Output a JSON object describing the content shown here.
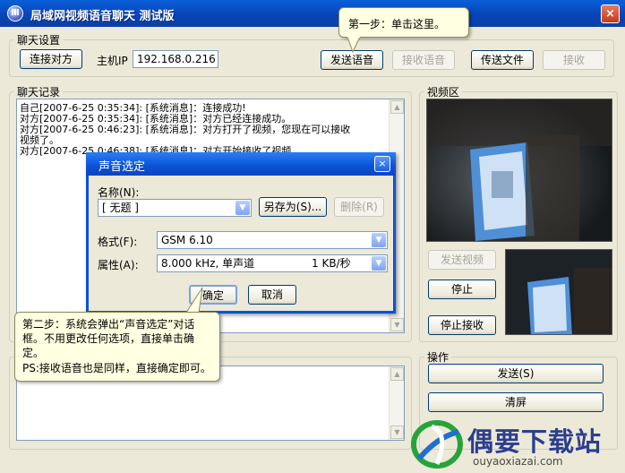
{
  "window": {
    "title": "局域网视频语音聊天  测试版",
    "close_label": "×",
    "icon_label": "Ⅲ"
  },
  "chat_settings": {
    "group_label": "聊天设置",
    "connect_label": "连接对方",
    "host_ip_label": "主机IP",
    "host_ip_value": "192.168.0.216",
    "send_voice_label": "发送语音",
    "receive_voice_label": "接收语音",
    "send_file_label": "传送文件",
    "receive_label": "接收"
  },
  "chat_log": {
    "group_label": "聊天记录",
    "lines": [
      "自己[2007-6-25 0:35:34]: [系统消息]：连接成功!",
      "对方[2007-6-25 0:35:34]: [系统消息]：对方已经连接成功。",
      "对方[2007-6-25 0:46:23]: [系统消息]：对方打开了视频，您现在可以接收",
      "视频了。",
      "对方[2007-6-25 0:46:38]: [系统消息]：对方开始接收了视频"
    ]
  },
  "video": {
    "group_label": "视频区",
    "send_video_label": "发送视频",
    "stop_label": "停止",
    "stop_receive_label": "停止接收"
  },
  "operations": {
    "group_label": "操作",
    "send_label": "发送(S)",
    "clear_label": "清屏"
  },
  "sound_dialog": {
    "title": "声音选定",
    "close_label": "×",
    "name_label": "名称(N):",
    "name_value": "[ 无题 ]",
    "save_as_label": "另存为(S)...",
    "delete_label": "删除(R)",
    "format_label": "格式(F):",
    "format_value": "GSM 6.10",
    "attribute_label": "属性(A):",
    "attribute_value": "8.000 kHz, 单声道",
    "attribute_rate": "1 KB/秒",
    "ok_label": "确定",
    "cancel_label": "取消"
  },
  "tooltip_step1": {
    "text": "第一步：单击这里。"
  },
  "tooltip_step2": {
    "lines": [
      "第二步：系统会弹出“声音选定”对话",
      "框。不用更改任何选项，直接单击确",
      "定。",
      "PS:接收语音也是同样，直接确定即可。"
    ]
  },
  "watermark": {
    "brand": "偶要下载站",
    "url": "ouyaoxiazai.com"
  },
  "colors": {
    "titlebar": "#0845b8",
    "window_bg": "#ece9d8",
    "tooltip_bg": "#ffffe1",
    "dialog_border": "#0a52d6"
  }
}
